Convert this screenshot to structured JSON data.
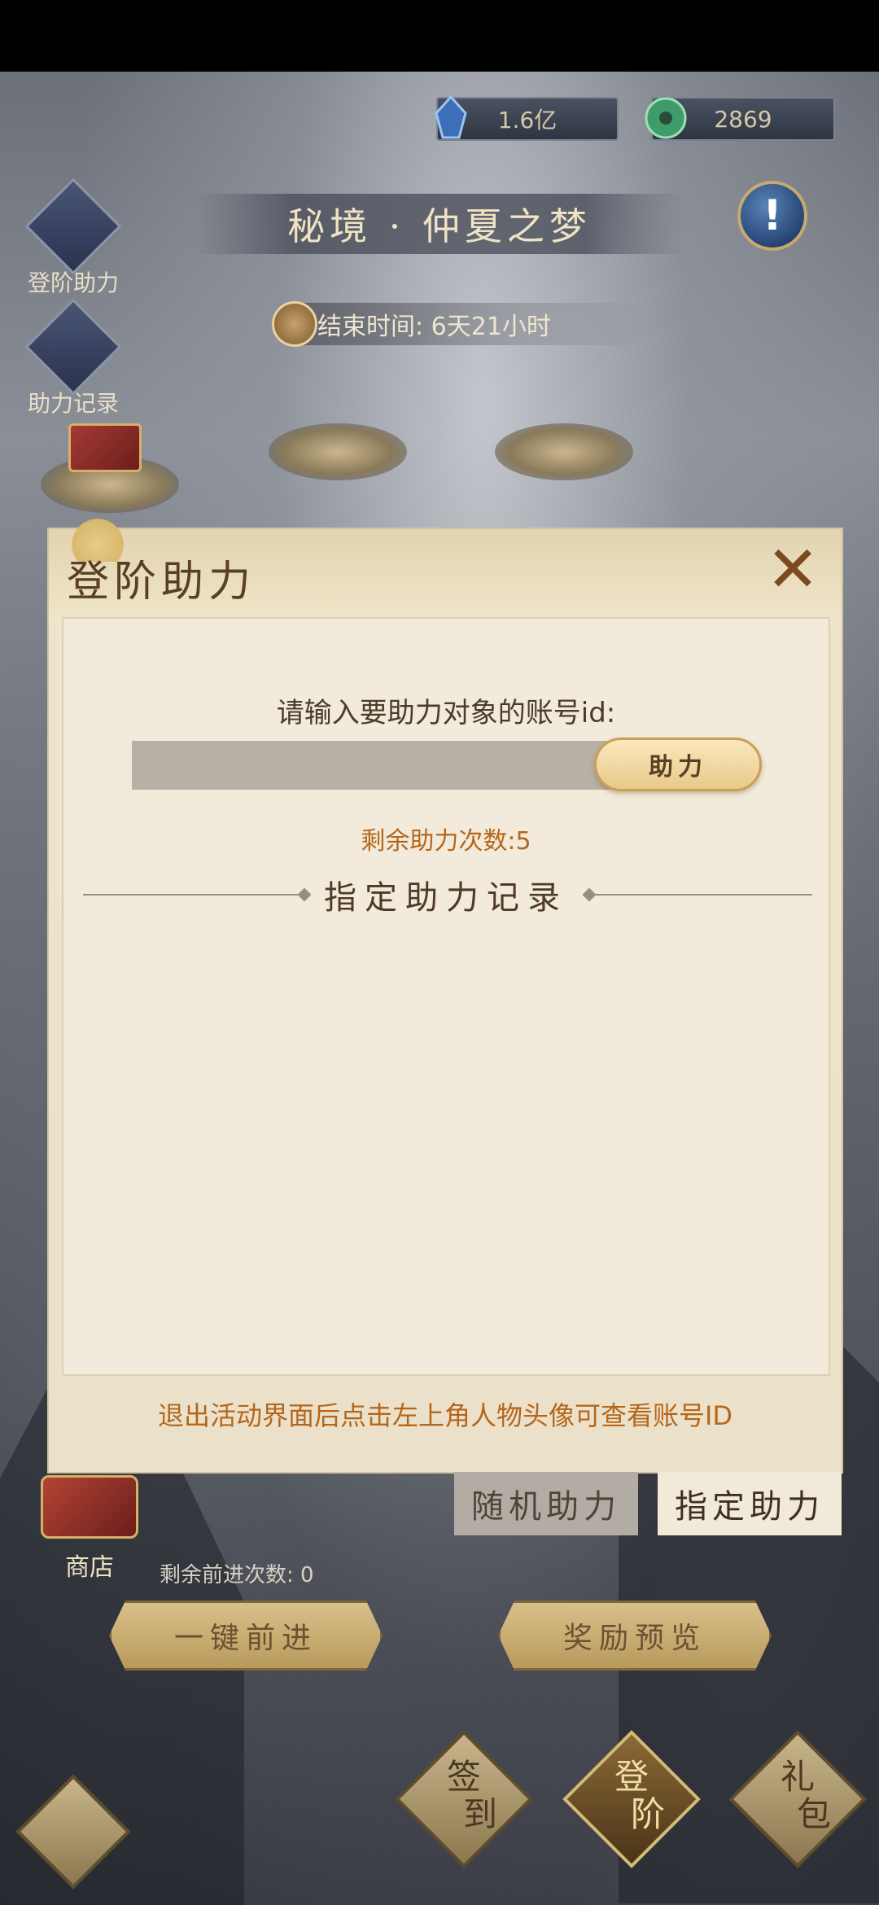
{
  "currencies": [
    {
      "icon": "crystal-icon",
      "value": "1.6亿"
    },
    {
      "icon": "jade-coin-icon",
      "value": "2869"
    }
  ],
  "event": {
    "title": "秘境 · 仲夏之梦",
    "end_time": "结束时间:  6天21小时"
  },
  "sidebar": {
    "items": [
      {
        "label": "登阶助力"
      },
      {
        "label": "助力记录"
      }
    ]
  },
  "modal": {
    "title": "登阶助力",
    "prompt": "请输入要助力对象的账号id:",
    "input": {
      "value": "",
      "placeholder": ""
    },
    "assist_button": "助力",
    "remaining": "剩余助力次数:5",
    "record_title": "指定助力记录",
    "hint": "退出活动界面后点击左上角人物头像可查看账号ID"
  },
  "tabs": [
    {
      "label": "随机助力",
      "active": false
    },
    {
      "label": "指定助力",
      "active": true
    }
  ],
  "shop": {
    "label": "商店"
  },
  "remaining_steps": "剩余前进次数: 0",
  "actions": {
    "advance": "一键前进",
    "preview": "奖励预览"
  },
  "bottom_nav": [
    {
      "label_1": "签",
      "label_2": "到"
    },
    {
      "label_1": "登",
      "label_2": "阶"
    },
    {
      "label_1": "礼",
      "label_2": "包"
    }
  ],
  "colors": {
    "accent_orange": "#b5661a",
    "modal_bg": "#efe5cf",
    "title_brown": "#5b3f24"
  }
}
